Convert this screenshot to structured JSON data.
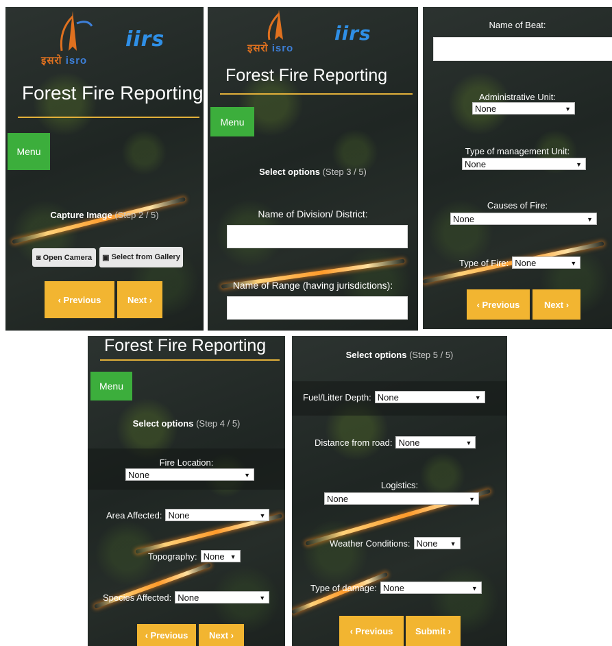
{
  "app": {
    "title": "Forest Fire Reporting",
    "menu_label": "Menu",
    "isro_hindi": "इसरो",
    "isro_english": "isro",
    "iirs_label": "iirs",
    "colors": {
      "accent_yellow": "#f2b531",
      "menu_green": "#3cae3c",
      "title_rule": "#e2b03a",
      "iirs_blue": "#2f8fe6",
      "isro_orange": "#e0711f"
    }
  },
  "screen1": {
    "heading": "Capture Image",
    "step": "(Step 2 / 5)",
    "open_camera": {
      "label": "Open Camera",
      "icon": "camera-icon"
    },
    "gallery": {
      "label": "Select from Gallery",
      "icon": "image-icon"
    },
    "prev": "‹ Previous",
    "next": "Next ›"
  },
  "screen2": {
    "heading": "Select options",
    "step": "(Step 3 / 5)",
    "division_label": "Name of Division/ District:",
    "division_value": "",
    "range_label": "Name of Range (having jurisdictions):",
    "range_value": ""
  },
  "screen3": {
    "beat_label": "Name of Beat:",
    "beat_value": "",
    "admin_unit_label": "Administrative Unit:",
    "admin_unit_value": "None",
    "mgmt_unit_label": "Type of management Unit:",
    "mgmt_unit_value": "None",
    "causes_label": "Causes of Fire:",
    "causes_value": "None",
    "fire_type_label": "Type of Fire:",
    "fire_type_value": "None",
    "prev": "‹ Previous",
    "next": "Next ›"
  },
  "screen4": {
    "heading": "Select options",
    "step": "(Step 4 / 5)",
    "fire_location_label": "Fire Location:",
    "fire_location_value": "None",
    "area_label": "Area Affected:",
    "area_value": "None",
    "topo_label": "Topography:",
    "topo_value": "None",
    "species_label": "Species Affected:",
    "species_value": "None",
    "prev": "‹ Previous",
    "next": "Next ›"
  },
  "screen5": {
    "heading": "Select options",
    "step": "(Step 5 / 5)",
    "fuel_label": "Fuel/Litter Depth:",
    "fuel_value": "None",
    "distance_label": "Distance from road:",
    "distance_value": "None",
    "logistics_label": "Logistics:",
    "logistics_value": "None",
    "weather_label": "Weather Conditions:",
    "weather_value": "None",
    "damage_label": "Type of damage:",
    "damage_value": "None",
    "prev": "‹ Previous",
    "submit": "Submit ›"
  }
}
